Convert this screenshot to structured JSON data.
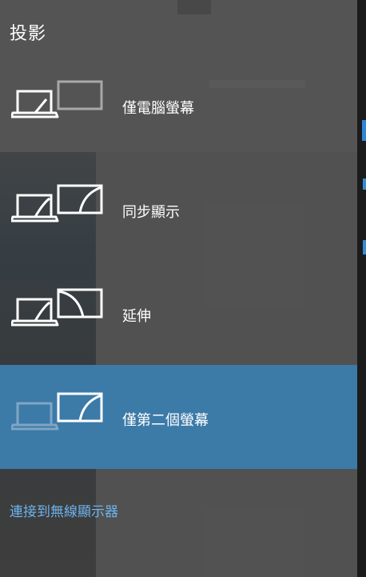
{
  "title": "投影",
  "options": [
    {
      "label": "僅電腦螢幕",
      "selected": false
    },
    {
      "label": "同步顯示",
      "selected": false
    },
    {
      "label": "延伸",
      "selected": false
    },
    {
      "label": "僅第二個螢幕",
      "selected": true
    }
  ],
  "connect_link": "連接到無線顯示器",
  "colors": {
    "selected_bg": "#3c7aa8",
    "link": "#6db3ee",
    "accent": "#2f86d6"
  },
  "icons": [
    "pc-screen-only-icon",
    "duplicate-icon",
    "extend-icon",
    "second-screen-only-icon"
  ]
}
